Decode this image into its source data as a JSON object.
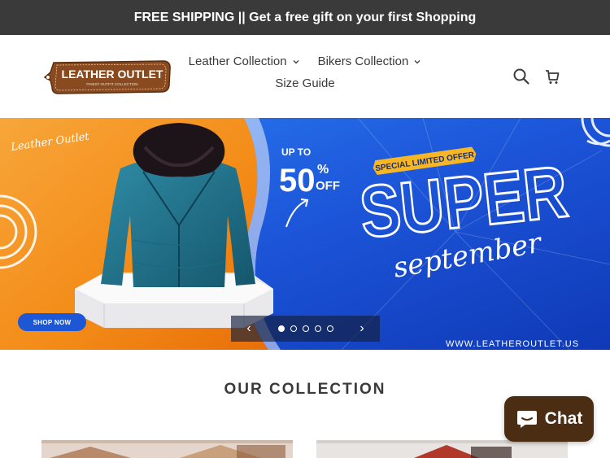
{
  "announcement": "FREE SHIPPING || Get a free gift on your first Shopping",
  "logo": {
    "name": "LEATHER OUTLET",
    "tagline": "FINEST OUTFIT COLLECTION"
  },
  "nav": {
    "items": [
      {
        "label": "Leather Collection",
        "has_dropdown": true
      },
      {
        "label": "Bikers Collection",
        "has_dropdown": true
      },
      {
        "label": "Size Guide",
        "has_dropdown": false
      }
    ]
  },
  "header_icons": [
    "search-icon",
    "cart-icon"
  ],
  "hero": {
    "brand_script": "Leather Outlet",
    "discount_prefix": "UP TO",
    "discount_value": "50",
    "discount_unit": "%",
    "discount_suffix": "OFF",
    "badge": "SPECIAL LIMITED OFFER",
    "headline": "SUPER",
    "headline_script": "september",
    "shop_now": "SHOP NOW",
    "website": "WWW.LEATHEROUTLET.US",
    "carousel": {
      "slides": 5,
      "active": 1
    }
  },
  "collection_title": "OUR COLLECTION",
  "chat_label": "Chat",
  "colors": {
    "announcement_bg": "#3a3a3a",
    "hero_blue": "#1c54d8",
    "hero_orange": "#f38a16",
    "chat_bg": "#4a2d12",
    "logo_brown": "#8a4a1f"
  }
}
